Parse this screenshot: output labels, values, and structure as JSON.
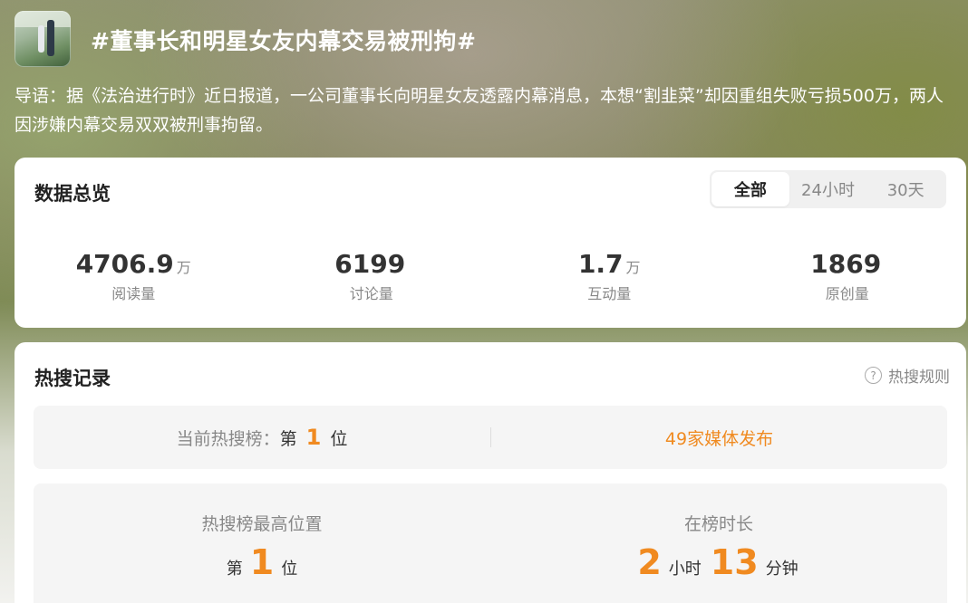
{
  "header": {
    "title": "#董事长和明星女友内幕交易被刑拘#",
    "thumbnail": "topic-thumbnail-photo"
  },
  "intro": "导语：据《法治进行时》近日报道，一公司董事长向明星女友透露内幕消息，本想“割韭菜”却因重组失败亏损500万，两人因涉嫌内幕交易双双被刑事拘留。",
  "overview": {
    "title": "数据总览",
    "tabs": [
      "全部",
      "24小时",
      "30天"
    ],
    "active_tab": "全部",
    "stats": [
      {
        "value": "4706.9",
        "unit": "万",
        "label": "阅读量"
      },
      {
        "value": "6199",
        "unit": "",
        "label": "讨论量"
      },
      {
        "value": "1.7",
        "unit": "万",
        "label": "互动量"
      },
      {
        "value": "1869",
        "unit": "",
        "label": "原创量"
      }
    ]
  },
  "hot_record": {
    "title": "热搜记录",
    "rules_label": "热搜规则",
    "rules_icon": "question-circle-icon",
    "current_rank": {
      "prefix": "当前热搜榜：",
      "pre": "第",
      "rank": "1",
      "post": "位"
    },
    "media": "49家媒体发布",
    "peak": {
      "title": "热搜榜最高位置",
      "pre": "第",
      "rank": "1",
      "post": "位"
    },
    "duration": {
      "title": "在榜时长",
      "hours": "2",
      "hours_unit": "小时",
      "minutes": "13",
      "minutes_unit": "分钟"
    }
  },
  "colors": {
    "accent": "#f08a20",
    "card": "#ffffff",
    "panel": "#f5f5f5"
  }
}
